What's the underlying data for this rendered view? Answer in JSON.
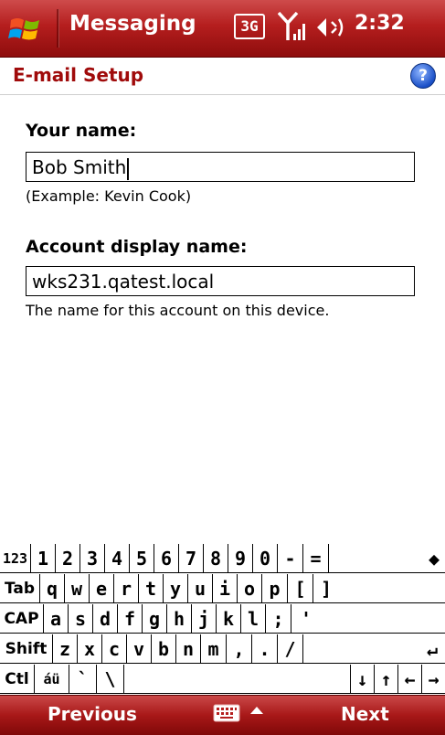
{
  "titlebar": {
    "app_title": "Messaging",
    "network": "3G",
    "time": "2:32"
  },
  "header": {
    "title": "E-mail Setup",
    "help": "?"
  },
  "form": {
    "name_label": "Your name:",
    "name_value": "Bob Smith",
    "name_hint": "(Example: Kevin Cook)",
    "display_label": "Account display name:",
    "display_value": "wks231.qatest.local",
    "display_hint": "The name for this account on this device."
  },
  "keyboard": {
    "rows": [
      [
        "123",
        "1",
        "2",
        "3",
        "4",
        "5",
        "6",
        "7",
        "8",
        "9",
        "0",
        "-",
        "=",
        "◆"
      ],
      [
        "Tab",
        "q",
        "w",
        "e",
        "r",
        "t",
        "y",
        "u",
        "i",
        "o",
        "p",
        "[",
        "]"
      ],
      [
        "CAP",
        "a",
        "s",
        "d",
        "f",
        "g",
        "h",
        "j",
        "k",
        "l",
        ";",
        "'"
      ],
      [
        "Shift",
        "z",
        "x",
        "c",
        "v",
        "b",
        "n",
        "m",
        ",",
        ".",
        "/",
        "↵"
      ],
      [
        "Ctl",
        "áü",
        "`",
        "\\",
        "",
        "↓",
        "↑",
        "←",
        "→"
      ]
    ]
  },
  "softkeys": {
    "left": "Previous",
    "right": "Next"
  }
}
